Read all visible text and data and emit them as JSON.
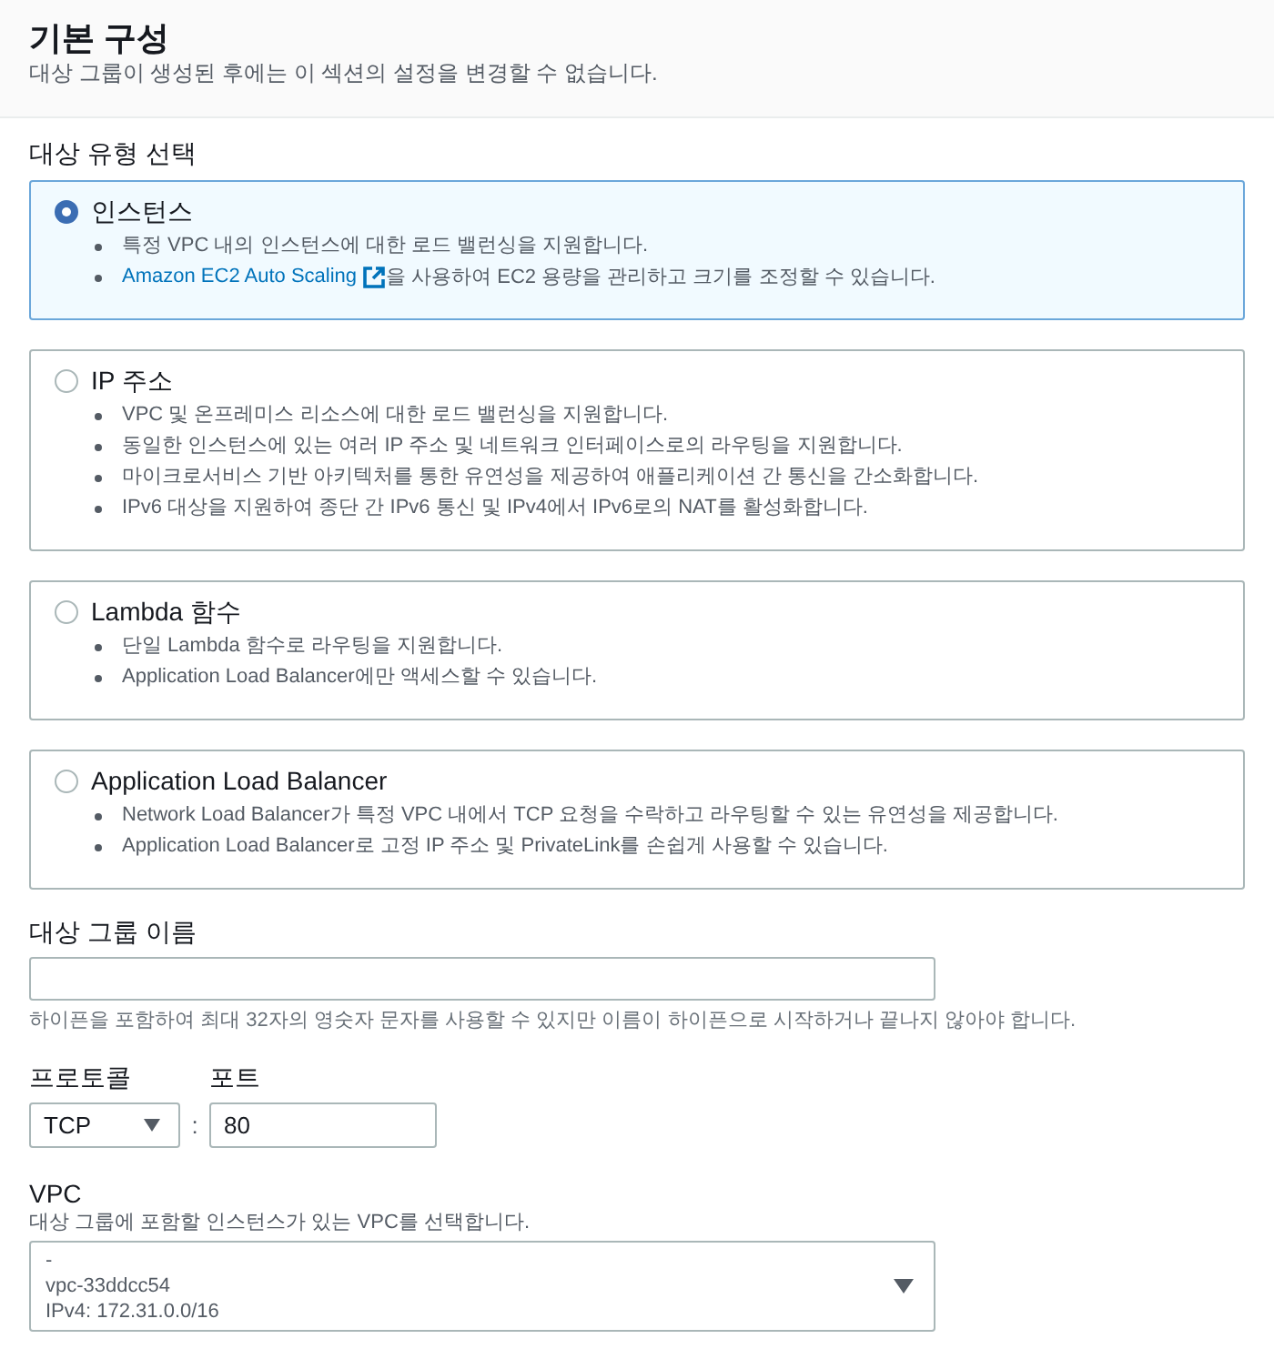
{
  "section": {
    "title": "기본 구성",
    "description": "대상 그룹이 생성된 후에는 이 섹션의 설정을 변경할 수 없습니다."
  },
  "target_type": {
    "label": "대상 유형 선택",
    "options": [
      {
        "title": "인스턴스",
        "selected": true,
        "bullets": [
          {
            "kind": "text",
            "text": "특정 VPC 내의 인스턴스에 대한 로드 밸런싱을 지원합니다."
          },
          {
            "kind": "link",
            "link": "Amazon EC2 Auto Scaling",
            "text": "을 사용하여 EC2 용량을 관리하고 크기를 조정할 수 있습니다."
          }
        ]
      },
      {
        "title": "IP 주소",
        "selected": false,
        "bullets": [
          {
            "kind": "text",
            "text": "VPC 및 온프레미스 리소스에 대한 로드 밸런싱을 지원합니다."
          },
          {
            "kind": "text",
            "text": "동일한 인스턴스에 있는 여러 IP 주소 및 네트워크 인터페이스로의 라우팅을 지원합니다."
          },
          {
            "kind": "text",
            "text": "마이크로서비스 기반 아키텍처를 통한 유연성을 제공하여 애플리케이션 간 통신을 간소화합니다."
          },
          {
            "kind": "text",
            "text": "IPv6 대상을 지원하여 종단 간 IPv6 통신 및 IPv4에서 IPv6로의 NAT를 활성화합니다."
          }
        ]
      },
      {
        "title": "Lambda 함수",
        "selected": false,
        "bullets": [
          {
            "kind": "text",
            "text": "단일 Lambda 함수로 라우팅을 지원합니다."
          },
          {
            "kind": "text",
            "text": "Application Load Balancer에만 액세스할 수 있습니다."
          }
        ]
      },
      {
        "title": "Application Load Balancer",
        "selected": false,
        "bullets": [
          {
            "kind": "text",
            "text": "Network Load Balancer가 특정 VPC 내에서 TCP 요청을 수락하고 라우팅할 수 있는 유연성을 제공합니다."
          },
          {
            "kind": "text",
            "text": "Application Load Balancer로 고정 IP 주소 및 PrivateLink를 손쉽게 사용할 수 있습니다."
          }
        ]
      }
    ]
  },
  "target_group_name": {
    "label": "대상 그룹 이름",
    "hint": "하이픈을 포함하여 최대 32자의 영숫자 문자를 사용할 수 있지만 이름이 하이픈으로 시작하거나 끝나지 않아야 합니다."
  },
  "protocol": {
    "label": "프로토콜",
    "value": "TCP"
  },
  "separator": ":",
  "port": {
    "label": "포트",
    "value": "80"
  },
  "vpc": {
    "label": "VPC",
    "description": "대상 그룹에 포함할 인스턴스가 있는 VPC를 선택합니다.",
    "lines": [
      "-",
      "vpc-33ddcc54",
      "IPv4: 172.31.0.0/16"
    ]
  }
}
